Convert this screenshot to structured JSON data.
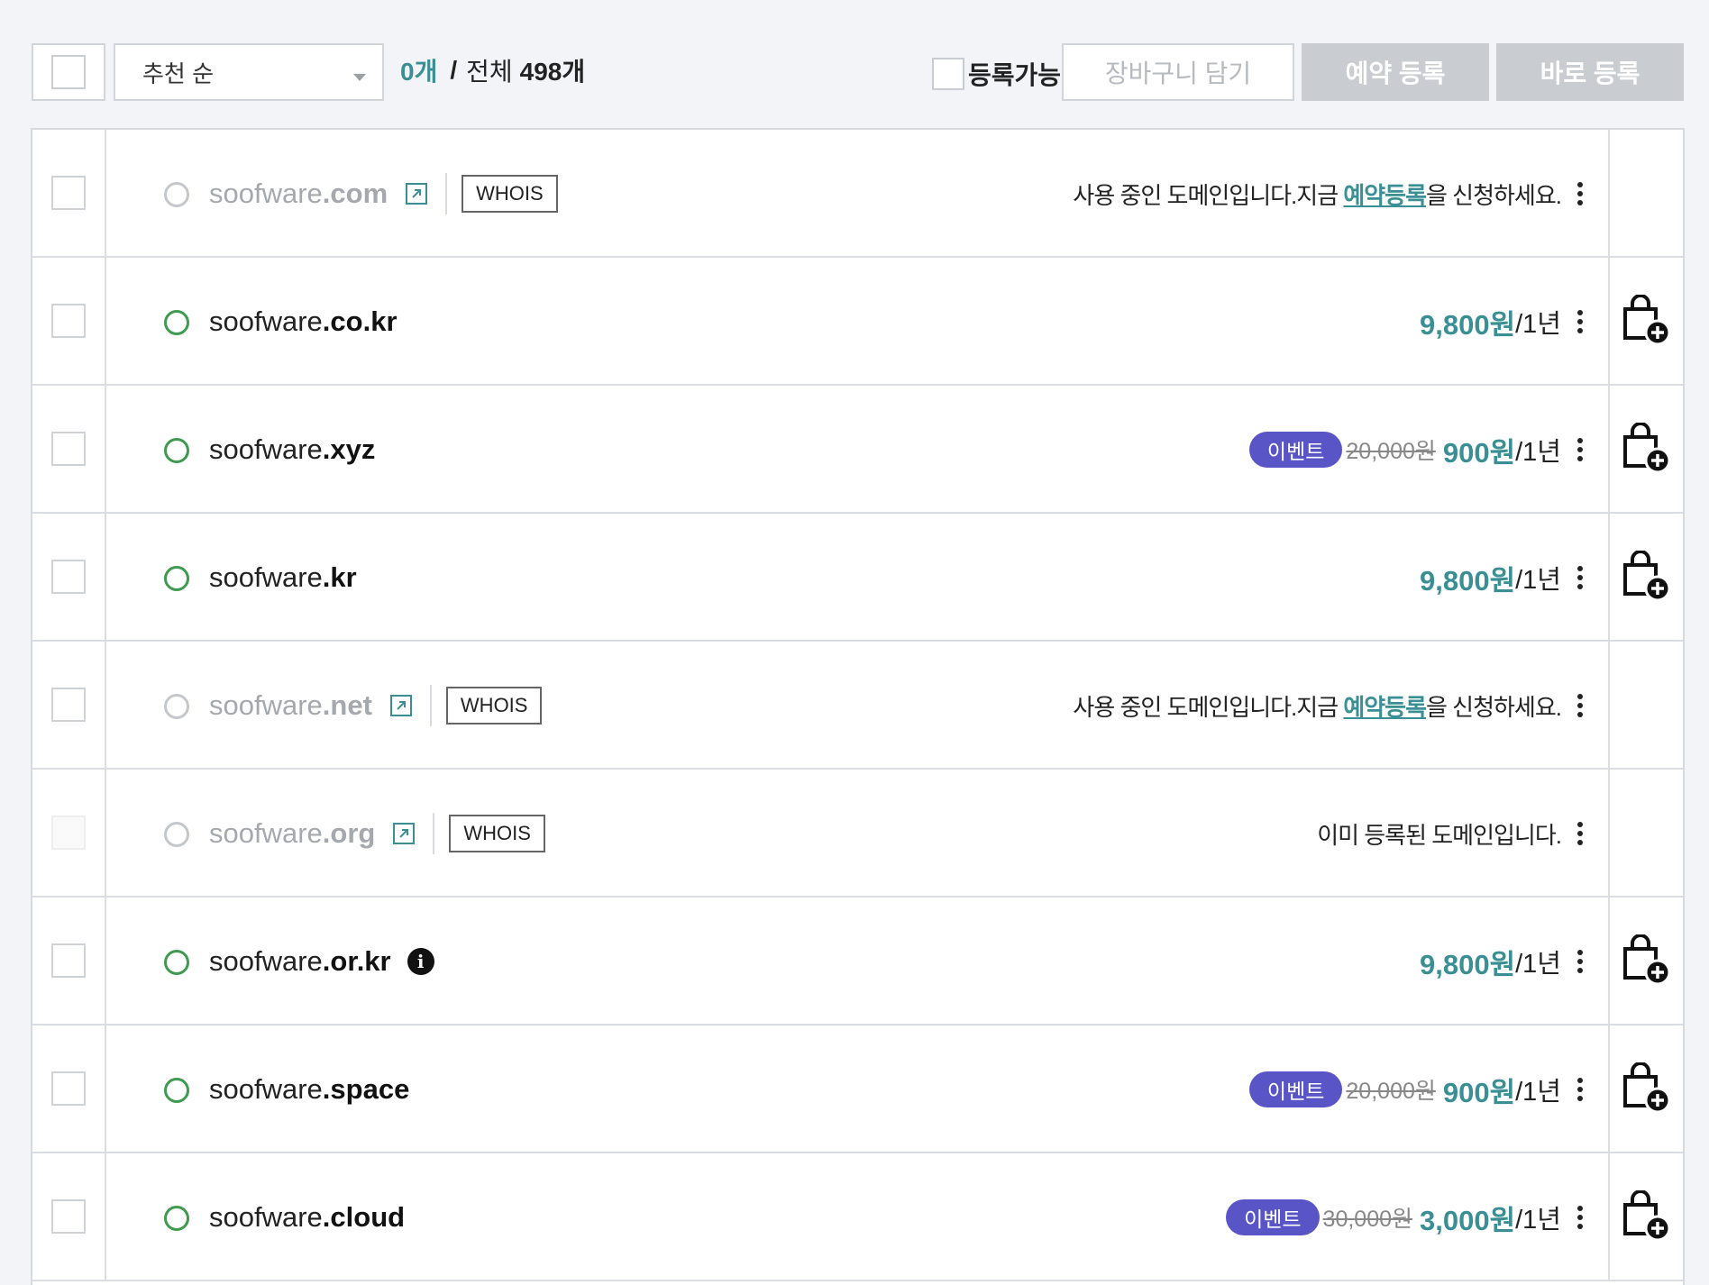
{
  "toolbar": {
    "sort_label": "추천 순",
    "selected_count": "0개",
    "separator": "/",
    "total_label": "전체",
    "total_count": "498개",
    "available_label": "등록가능",
    "cart_button": "장바구니 담기",
    "reserve_button": "예약 등록",
    "register_button": "바로 등록"
  },
  "rows": [
    {
      "base": "soofware",
      "tld": ".com",
      "status": "taken",
      "whois": "WHOIS",
      "msg_pre": "사용 중인 도메인입니다.지금 ",
      "msg_link": "예약등록",
      "msg_post": "을 신청하세요."
    },
    {
      "base": "soofware",
      "tld": ".co.kr",
      "status": "available",
      "price": "9,800원",
      "period": "/1년"
    },
    {
      "base": "soofware",
      "tld": ".xyz",
      "status": "available",
      "badge": "이벤트",
      "old_price": "20,000원",
      "price": "900원",
      "period": "/1년"
    },
    {
      "base": "soofware",
      "tld": ".kr",
      "status": "available",
      "price": "9,800원",
      "period": "/1년"
    },
    {
      "base": "soofware",
      "tld": ".net",
      "status": "taken",
      "whois": "WHOIS",
      "msg_pre": "사용 중인 도메인입니다.지금 ",
      "msg_link": "예약등록",
      "msg_post": "을 신청하세요."
    },
    {
      "base": "soofware",
      "tld": ".org",
      "status": "registered",
      "whois": "WHOIS",
      "msg": "이미 등록된 도메인입니다."
    },
    {
      "base": "soofware",
      "tld": ".or.kr",
      "status": "available",
      "info": "i",
      "price": "9,800원",
      "period": "/1년"
    },
    {
      "base": "soofware",
      "tld": ".space",
      "status": "available",
      "badge": "이벤트",
      "old_price": "20,000원",
      "price": "900원",
      "period": "/1년"
    },
    {
      "base": "soofware",
      "tld": ".cloud",
      "status": "available",
      "badge": "이벤트",
      "old_price": "30,000원",
      "price": "3,000원",
      "period": "/1년"
    }
  ],
  "colors": {
    "accent": "#3a8f95",
    "available_dot": "#3e9b4f",
    "event_badge": "#5a55c6",
    "disabled_button": "#c9cdd2"
  }
}
